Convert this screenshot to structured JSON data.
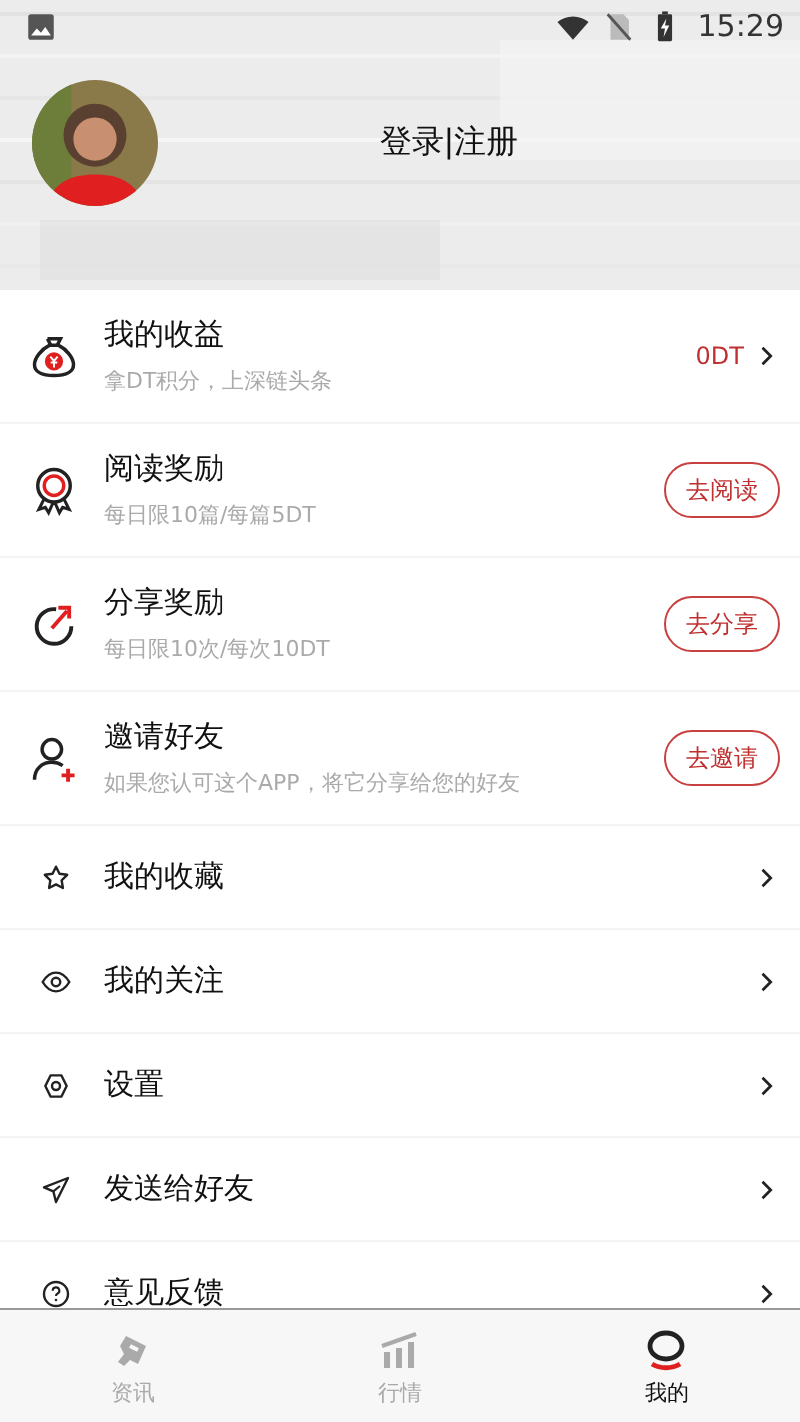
{
  "status_bar": {
    "time": "15:29"
  },
  "header": {
    "login_text": "登录|注册"
  },
  "reward_items": [
    {
      "kind": "value",
      "title": "我的收益",
      "subtitle": "拿DT积分，上深链头条",
      "value": "0DT"
    },
    {
      "kind": "action",
      "title": "阅读奖励",
      "subtitle": "每日限10篇/每篇5DT",
      "button": "去阅读"
    },
    {
      "kind": "action",
      "title": "分享奖励",
      "subtitle": "每日限10次/每次10DT",
      "button": "去分享"
    },
    {
      "kind": "action",
      "title": "邀请好友",
      "subtitle": "如果您认可这个APP，将它分享给您的好友",
      "button": "去邀请"
    }
  ],
  "menu_items": [
    {
      "title": "我的收藏"
    },
    {
      "title": "我的关注"
    },
    {
      "title": "设置"
    },
    {
      "title": "发送给好友"
    },
    {
      "title": "意见反馈"
    }
  ],
  "tabs": [
    {
      "label": "资讯",
      "selected": false
    },
    {
      "label": "行情",
      "selected": false
    },
    {
      "label": "我的",
      "selected": true
    }
  ]
}
